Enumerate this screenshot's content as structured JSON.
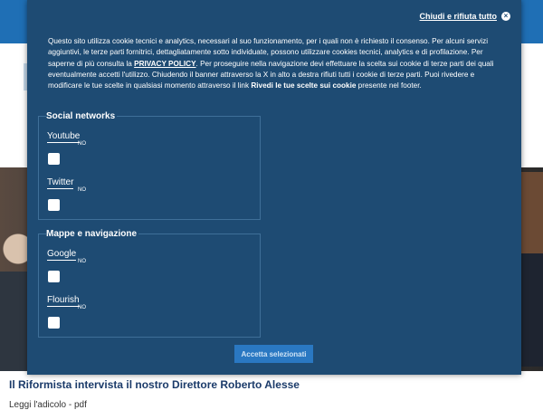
{
  "banner": {
    "close_label": "Chiudi e rifiuta tutto",
    "intro": {
      "part1": "Questo sito utilizza cookie tecnici e analytics, necessari al suo funzionamento, per i quali non è richiesto il consenso. Per alcuni servizi aggiuntivi, le terze parti fornitrici, dettagliatamente sotto individuate, possono utilizzare cookies tecnici, analytics e di profilazione. Per saperne di più consulta la ",
      "privacy_link": "PRIVACY POLICY",
      "part2": ". Per proseguire nella navigazione devi effettuare la scelta sui cookie di terze parti dei quali eventualmente accetti l'utilizzo. Chiudendo il banner attraverso la X in alto a destra rifiuti tutti i cookie di terze parti. Puoi rivedere e modificare le tue scelte in qualsiasi momento attraverso il link ",
      "review_link": "Rivedi le tue scelte sui cookie",
      "part3": " presente nel footer."
    },
    "groups": [
      {
        "title": "Social networks",
        "services": [
          {
            "name": "Youtube",
            "state": "NO"
          },
          {
            "name": "Twitter",
            "state": "NO"
          }
        ]
      },
      {
        "title": "Mappe e navigazione",
        "services": [
          {
            "name": "Google",
            "state": "NO"
          },
          {
            "name": "Flourish",
            "state": "NO"
          }
        ]
      }
    ],
    "accept_label": "Accetta selezionati"
  },
  "page": {
    "headline": "Il Riformista intervista il nostro Direttore Roberto Alesse",
    "link_text": "Leggi l'adicolo - pdf"
  },
  "colors": {
    "banner_bg": "#1e4b73",
    "header_blue": "#1f6fb5",
    "accept_button": "#2a78c2"
  }
}
